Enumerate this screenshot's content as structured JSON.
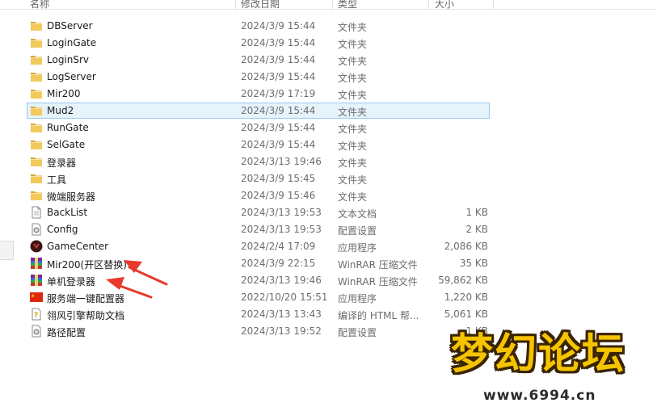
{
  "header": {
    "name": "名称",
    "date": "修改日期",
    "type": "类型",
    "size": "大小"
  },
  "files": [
    {
      "name": "DBServer",
      "date": "2024/3/9 15:44",
      "type": "文件夹",
      "size": "",
      "icon": "folder-icon"
    },
    {
      "name": "LoginGate",
      "date": "2024/3/9 15:44",
      "type": "文件夹",
      "size": "",
      "icon": "folder-icon"
    },
    {
      "name": "LoginSrv",
      "date": "2024/3/9 15:44",
      "type": "文件夹",
      "size": "",
      "icon": "folder-icon"
    },
    {
      "name": "LogServer",
      "date": "2024/3/9 15:44",
      "type": "文件夹",
      "size": "",
      "icon": "folder-icon"
    },
    {
      "name": "Mir200",
      "date": "2024/3/9 17:19",
      "type": "文件夹",
      "size": "",
      "icon": "folder-icon"
    },
    {
      "name": "Mud2",
      "date": "2024/3/9 15:44",
      "type": "文件夹",
      "size": "",
      "icon": "folder-icon",
      "selected": true
    },
    {
      "name": "RunGate",
      "date": "2024/3/9 15:44",
      "type": "文件夹",
      "size": "",
      "icon": "folder-icon"
    },
    {
      "name": "SelGate",
      "date": "2024/3/9 15:44",
      "type": "文件夹",
      "size": "",
      "icon": "folder-icon"
    },
    {
      "name": "登录器",
      "date": "2024/3/13 19:46",
      "type": "文件夹",
      "size": "",
      "icon": "folder-icon"
    },
    {
      "name": "工具",
      "date": "2024/3/9 15:45",
      "type": "文件夹",
      "size": "",
      "icon": "folder-icon"
    },
    {
      "name": "微端服务器",
      "date": "2024/3/9 15:46",
      "type": "文件夹",
      "size": "",
      "icon": "folder-icon"
    },
    {
      "name": "BackList",
      "date": "2024/3/13 19:53",
      "type": "文本文档",
      "size": "1 KB",
      "icon": "text-file-icon"
    },
    {
      "name": "Config",
      "date": "2024/3/13 19:53",
      "type": "配置设置",
      "size": "2 KB",
      "icon": "config-file-icon"
    },
    {
      "name": "GameCenter",
      "date": "2024/2/4 17:09",
      "type": "应用程序",
      "size": "2,086 KB",
      "icon": "game-center-app-icon"
    },
    {
      "name": "Mir200(开区替换)",
      "date": "2024/3/9 22:15",
      "type": "WinRAR 压缩文件",
      "size": "35 KB",
      "icon": "winrar-archive-icon"
    },
    {
      "name": "单机登录器",
      "date": "2024/3/13 19:46",
      "type": "WinRAR 压缩文件",
      "size": "59,862 KB",
      "icon": "winrar-archive-icon"
    },
    {
      "name": "服务端一键配置器",
      "date": "2022/10/20 15:51",
      "type": "应用程序",
      "size": "1,220 KB",
      "icon": "china-flag-app-icon"
    },
    {
      "name": "翎风引擎帮助文档",
      "date": "2024/3/13 13:43",
      "type": "编译的 HTML 帮...",
      "size": "5,061 KB",
      "icon": "chm-help-icon"
    },
    {
      "name": "路径配置",
      "date": "2024/3/13 19:52",
      "type": "配置设置",
      "size": "1 KB",
      "icon": "config-file-icon"
    }
  ],
  "watermark": {
    "title": "梦幻论坛",
    "url": "www.6994.cn"
  },
  "colors": {
    "selection_bg": "#e5f3fb",
    "selection_border": "#99c9ef",
    "folder": "#e8b84a",
    "arrow": "#e8392c"
  }
}
